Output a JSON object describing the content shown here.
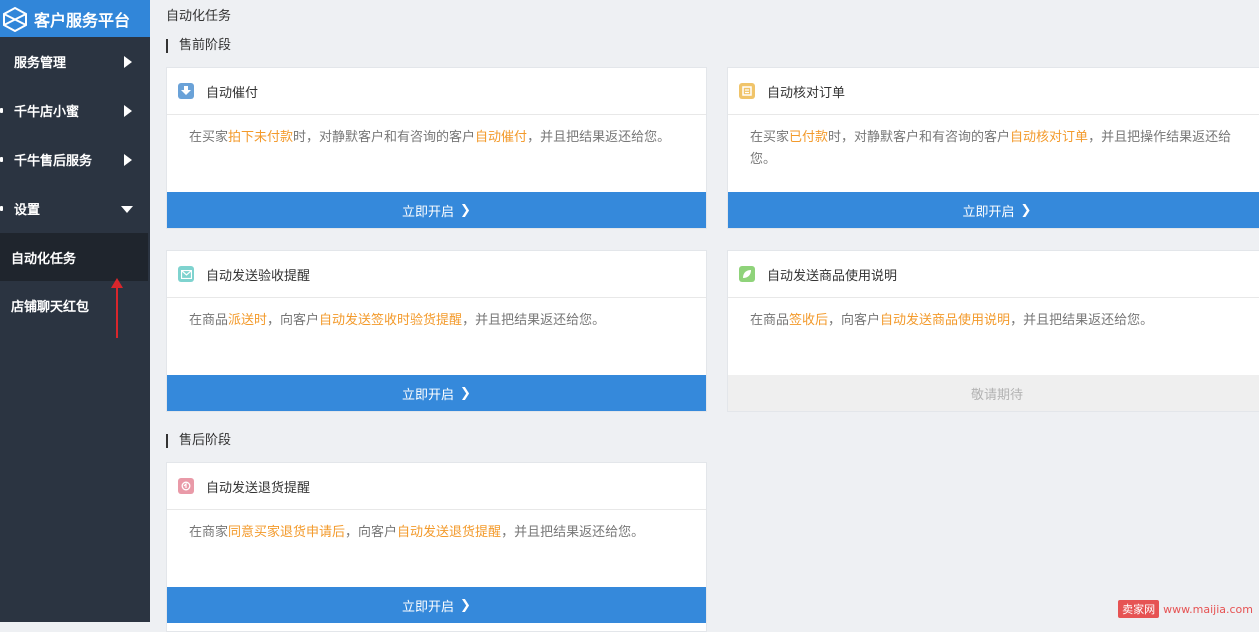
{
  "brand": {
    "title": "客户服务平台"
  },
  "sidebar": {
    "items": [
      {
        "label": "服务管理"
      },
      {
        "label": "千牛店小蜜"
      },
      {
        "label": "千牛售后服务"
      },
      {
        "label": "设置"
      }
    ],
    "sub_items": [
      {
        "label": "自动化任务",
        "active": true
      },
      {
        "label": "店铺聊天红包"
      }
    ]
  },
  "page": {
    "title": "自动化任务"
  },
  "sections": {
    "presale": "售前阶段",
    "aftersale": "售后阶段"
  },
  "cards": [
    {
      "title": "自动催付",
      "icon": "download-arrow-icon",
      "icon_color": "#6aa2d8",
      "desc": [
        {
          "t": "在买家",
          "h": false
        },
        {
          "t": "拍下未付款",
          "h": true
        },
        {
          "t": "时，对静默客户和有咨询的客户",
          "h": false
        },
        {
          "t": "自动催付",
          "h": true
        },
        {
          "t": "，并且把结果返还给您。",
          "h": false
        }
      ],
      "button": "立即开启",
      "enabled": true
    },
    {
      "title": "自动核对订单",
      "icon": "order-list-icon",
      "icon_color": "#f0c46a",
      "desc": [
        {
          "t": "在买家",
          "h": false
        },
        {
          "t": "已付款",
          "h": true
        },
        {
          "t": "时，对静默客户和有咨询的客户",
          "h": false
        },
        {
          "t": "自动核对订单",
          "h": true
        },
        {
          "t": "，并且把操作结果返还给您。",
          "h": false
        }
      ],
      "button": "立即开启",
      "enabled": true
    },
    {
      "title": "自动发送验收提醒",
      "icon": "mail-icon",
      "icon_color": "#7fd3cf",
      "desc": [
        {
          "t": "在商品",
          "h": false
        },
        {
          "t": "派送时",
          "h": true
        },
        {
          "t": "，向客户",
          "h": false
        },
        {
          "t": "自动发送签收时验货提醒",
          "h": true
        },
        {
          "t": "，并且把结果返还给您。",
          "h": false
        }
      ],
      "button": "立即开启",
      "enabled": true
    },
    {
      "title": "自动发送商品使用说明",
      "icon": "leaf-icon",
      "icon_color": "#8fd37a",
      "desc": [
        {
          "t": "在商品",
          "h": false
        },
        {
          "t": "签收后",
          "h": true
        },
        {
          "t": "，向客户",
          "h": false
        },
        {
          "t": "自动发送商品使用说明",
          "h": true
        },
        {
          "t": "，并且把结果返还给您。",
          "h": false
        }
      ],
      "button": "敬请期待",
      "enabled": false
    },
    {
      "title": "自动发送退货提醒",
      "icon": "return-icon",
      "icon_color": "#e99aa8",
      "desc": [
        {
          "t": "在商家",
          "h": false
        },
        {
          "t": "同意买家退货申请后",
          "h": true
        },
        {
          "t": "，向客户",
          "h": false
        },
        {
          "t": "自动发送退货提醒",
          "h": true
        },
        {
          "t": "，并且把结果返还给您。",
          "h": false
        }
      ],
      "button": "立即开启",
      "enabled": true
    }
  ],
  "watermark": {
    "brand": "卖家网",
    "url": "www.maijia.com"
  },
  "colors": {
    "accent": "#3589db",
    "highlight": "#f39a2b",
    "sidebar": "#2b3441"
  }
}
